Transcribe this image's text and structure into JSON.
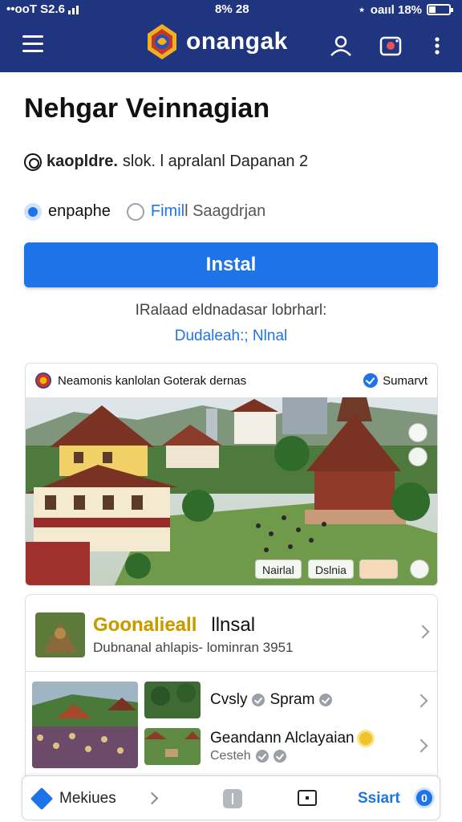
{
  "status_bar": {
    "carrier": "••ooT S2.6",
    "time": "8% 28",
    "right_text": "oaııl 18%"
  },
  "app_bar": {
    "brand": "onangak",
    "colors": {
      "bar": "#1f3580",
      "accent": "#1e73e8"
    },
    "icons": [
      "menu-icon",
      "account-icon",
      "camera-icon",
      "more-vert-icon"
    ]
  },
  "main": {
    "title": "Nehgar Veinnagian",
    "meta_bold": "kaopldre.",
    "meta_text": "slok. l apralanl Dapanan 2",
    "option_selected": "enpaphe",
    "option_other_highlight": "Fimil",
    "option_other_rest": "l Saagdrjan",
    "install_label": "Instal",
    "note": "IRalaad eldnadasar lobrharl:",
    "note_link": "Dudaleah:; Nlnal"
  },
  "photo_card": {
    "header": "Neamonis kanlolan Goterak dernas",
    "badge_label": "Sumarvt",
    "chips": [
      "Nairlal",
      "Dslnia"
    ]
  },
  "list": {
    "row1": {
      "title_gold": "Goonalieall",
      "title_rest": "llnsal",
      "subtitle": "Dubnanal ahlapis- lominran 3951"
    },
    "row2": {
      "title": "Cvsly",
      "tag": "Spram",
      "line2": "Geandann Alclayaian",
      "line3": "Cesteh"
    }
  },
  "bottom_bar": {
    "left_label": "Mekiues",
    "start_label": "Ssiart",
    "count": "0"
  }
}
